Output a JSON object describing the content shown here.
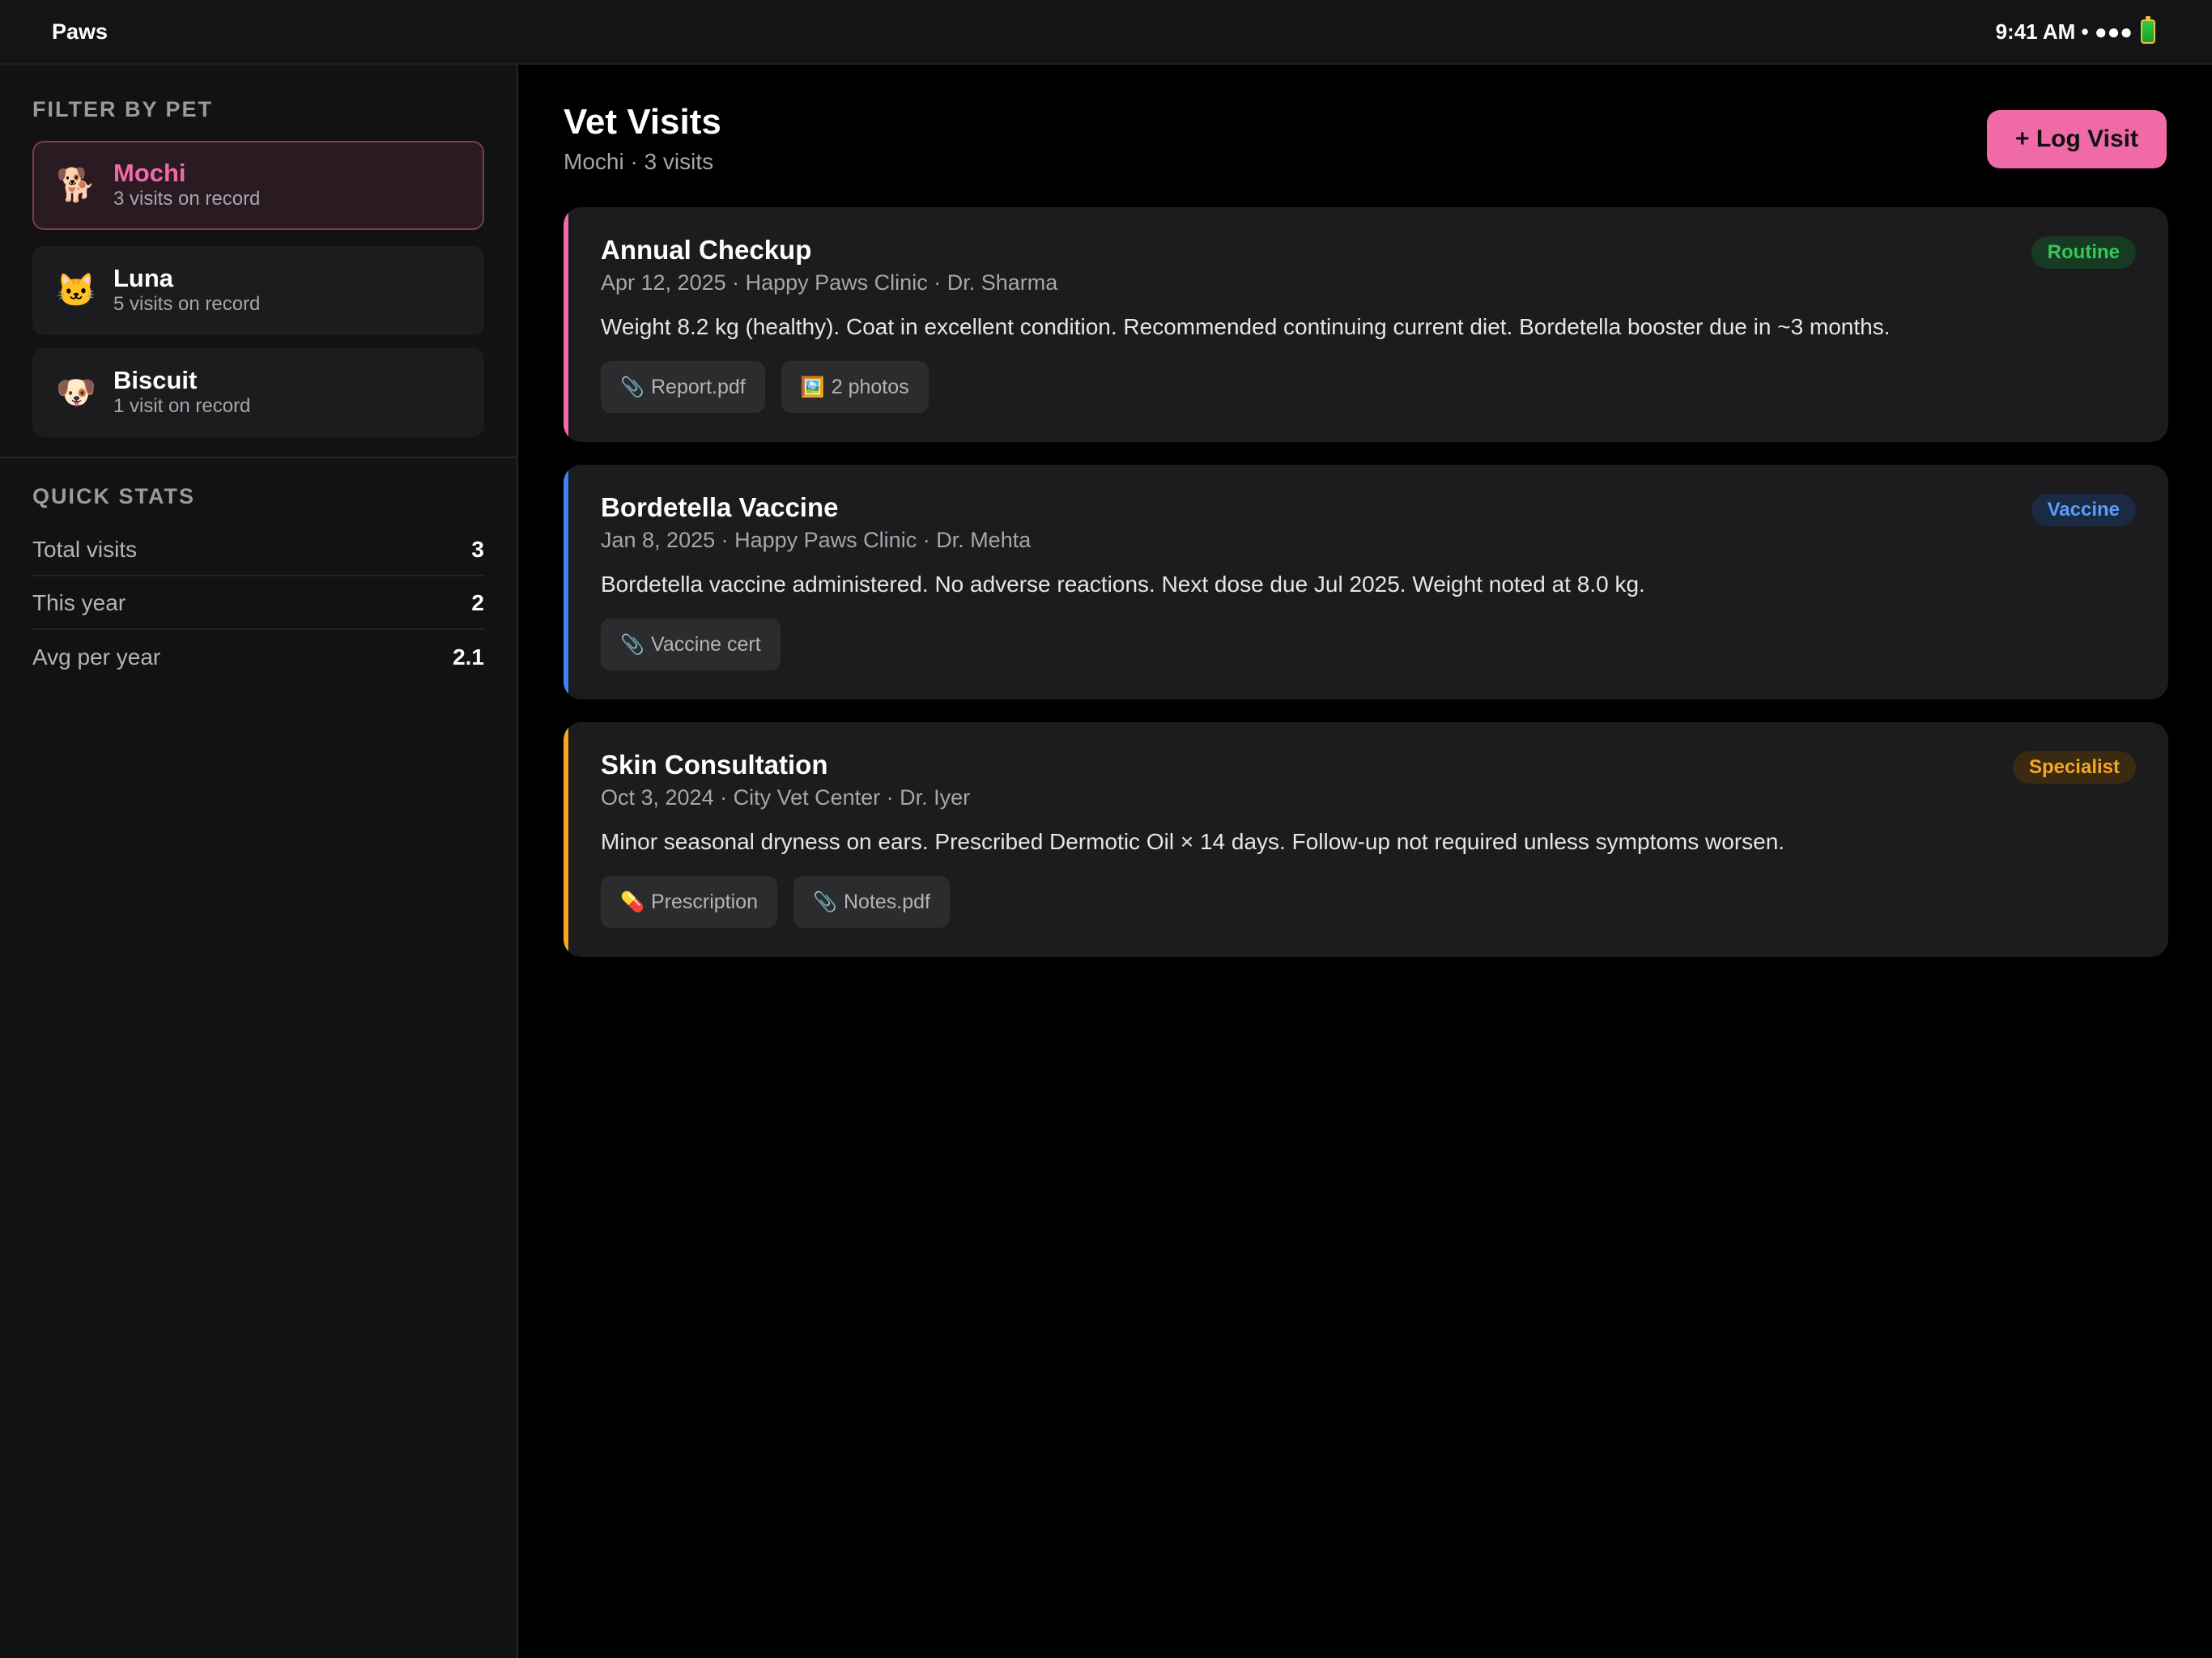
{
  "status_bar": {
    "app_name": "Paws",
    "time_and_signal": "9:41 AM • ●●●",
    "battery_icon": "battery-icon"
  },
  "sidebar": {
    "filter_heading": "FILTER BY PET",
    "pets": [
      {
        "emoji": "🐕",
        "name": "Mochi",
        "sub": "3 visits on record",
        "active": true
      },
      {
        "emoji": "🐱",
        "name": "Luna",
        "sub": "5 visits on record",
        "active": false
      },
      {
        "emoji": "🐶",
        "name": "Biscuit",
        "sub": "1 visit on record",
        "active": false
      }
    ],
    "stats_heading": "QUICK STATS",
    "stats": [
      {
        "label": "Total visits",
        "value": "3"
      },
      {
        "label": "This year",
        "value": "2"
      },
      {
        "label": "Avg per year",
        "value": "2.1"
      }
    ]
  },
  "main": {
    "title": "Vet Visits",
    "subtitle": "Mochi · 3 visits",
    "log_button": "+ Log Visit",
    "colors": {
      "accent": "#f06aa8"
    },
    "visits": [
      {
        "title": "Annual Checkup",
        "meta": "Apr 12, 2025 · Happy Paws Clinic · Dr. Sharma",
        "notes": "Weight 8.2 kg (healthy). Coat in excellent condition. Recommended continuing current diet. Bordetella booster due in ~3 months.",
        "tag": "Routine",
        "accent_color": "#f06aa8",
        "tag_color": "#34c759",
        "tag_bg": "#173a22",
        "attachments": [
          {
            "icon": "📎",
            "icon_name": "paperclip-icon",
            "label": "Report.pdf"
          },
          {
            "icon": "🖼️",
            "icon_name": "photo-icon",
            "label": "2 photos"
          }
        ]
      },
      {
        "title": "Bordetella Vaccine",
        "meta": "Jan 8, 2025 · Happy Paws Clinic · Dr. Mehta",
        "notes": "Bordetella vaccine administered. No adverse reactions. Next dose due Jul 2025. Weight noted at 8.0 kg.",
        "tag": "Vaccine",
        "accent_color": "#3b82f6",
        "tag_color": "#5b9cf5",
        "tag_bg": "#1a2a44",
        "attachments": [
          {
            "icon": "📎",
            "icon_name": "paperclip-icon",
            "label": "Vaccine cert"
          }
        ]
      },
      {
        "title": "Skin Consultation",
        "meta": "Oct 3, 2024 · City Vet Center · Dr. Iyer",
        "notes": "Minor seasonal dryness on ears. Prescribed Dermotic Oil × 14 days. Follow-up not required unless symptoms worsen.",
        "tag": "Specialist",
        "accent_color": "#f5a623",
        "tag_color": "#f5a623",
        "tag_bg": "#3a2a12",
        "attachments": [
          {
            "icon": "💊",
            "icon_name": "pill-icon",
            "label": "Prescription"
          },
          {
            "icon": "📎",
            "icon_name": "paperclip-icon",
            "label": "Notes.pdf"
          }
        ]
      }
    ]
  }
}
